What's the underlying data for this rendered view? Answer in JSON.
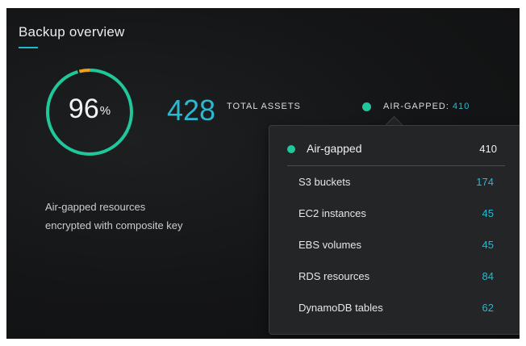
{
  "header": {
    "title": "Backup overview"
  },
  "gauge": {
    "value": "96",
    "unit": "%",
    "fraction": 0.96,
    "ring_color": "#1fc79a",
    "remainder_color": "#f0a020"
  },
  "totals": {
    "count": "428",
    "label": "TOTAL ASSETS"
  },
  "air_gapped": {
    "label": "AIR-GAPPED: ",
    "value": "410",
    "dot_color": "#1fc79a"
  },
  "description": {
    "line1": "Air-gapped resources",
    "line2": "encrypted with composite key"
  },
  "tooltip": {
    "header_label": "Air-gapped",
    "header_value": "410",
    "rows": [
      {
        "label": "S3 buckets",
        "value": "174"
      },
      {
        "label": "EC2 instances",
        "value": "45"
      },
      {
        "label": "EBS volumes",
        "value": "45"
      },
      {
        "label": "RDS resources",
        "value": "84"
      },
      {
        "label": "DynamoDB tables",
        "value": "62"
      }
    ]
  },
  "colors": {
    "accent": "#2bb8d0",
    "background": "#141516",
    "tooltip_bg": "#232527"
  }
}
